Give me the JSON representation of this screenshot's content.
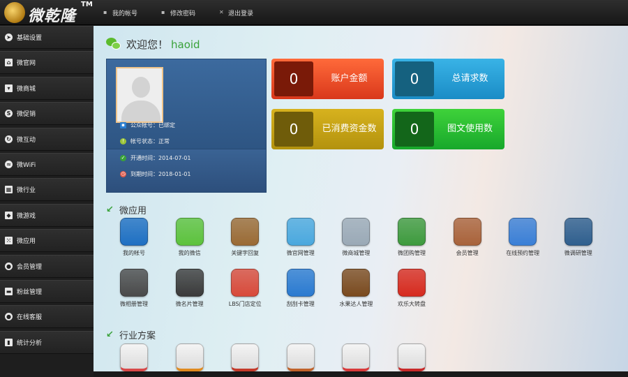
{
  "header": {
    "logo_text": "微乾隆",
    "logo_tm": "TM",
    "nav": [
      {
        "label": "我的帐号",
        "icon": "user-icon"
      },
      {
        "label": "修改密码",
        "icon": "edit-icon"
      },
      {
        "label": "退出登录",
        "icon": "close-icon"
      }
    ]
  },
  "sidebar": {
    "items": [
      {
        "label": "基础设置",
        "icon": "compass-icon"
      },
      {
        "label": "微官网",
        "icon": "home-icon"
      },
      {
        "label": "微商城",
        "icon": "cart-icon"
      },
      {
        "label": "微促销",
        "icon": "skype-icon"
      },
      {
        "label": "微互动",
        "icon": "refresh-icon"
      },
      {
        "label": "微WiFi",
        "icon": "wifi-icon"
      },
      {
        "label": "微行业",
        "icon": "grid-icon"
      },
      {
        "label": "微游戏",
        "icon": "gamepad-icon"
      },
      {
        "label": "微应用",
        "icon": "apps-icon"
      },
      {
        "label": "会员管理",
        "icon": "users-icon"
      },
      {
        "label": "粉丝管理",
        "icon": "card-icon"
      },
      {
        "label": "在线客服",
        "icon": "chat-users-icon"
      },
      {
        "label": "统计分析",
        "icon": "chart-icon"
      }
    ]
  },
  "welcome": {
    "prefix": "欢迎您！",
    "username": "haoid"
  },
  "profile": {
    "rows": [
      {
        "text": "公众帐号：已绑定",
        "icon": "flag-icon",
        "color": "#2b7fd1"
      },
      {
        "text": "帐号状态：正常",
        "icon": "status-icon",
        "color": "#9bc43a"
      },
      {
        "text": "开通时间：2014-07-01",
        "icon": "check-icon",
        "color": "#3aa23a"
      },
      {
        "text": "到期时间：2018-01-01",
        "icon": "alarm-icon",
        "color": "#e05a4a"
      }
    ]
  },
  "stats": [
    {
      "value": "0",
      "label": "账户金额",
      "color": "#e34a26"
    },
    {
      "value": "0",
      "label": "总请求数",
      "color": "#2aa0d6"
    },
    {
      "value": "0",
      "label": "已消费资金数",
      "color": "#c4a317"
    },
    {
      "value": "0",
      "label": "图文使用数",
      "color": "#25b82f"
    }
  ],
  "sections": {
    "apps_title": "微应用",
    "industry_title": "行业方案"
  },
  "apps": [
    {
      "label": "我的帐号",
      "icon": "account-icon",
      "color": "#1e6fc2"
    },
    {
      "label": "我的微信",
      "icon": "message-icon",
      "color": "#5cc23c"
    },
    {
      "label": "关键字回复",
      "icon": "notebook-icon",
      "color": "#9a6a34"
    },
    {
      "label": "微官网管理",
      "icon": "webcam-icon",
      "color": "#4aa8de"
    },
    {
      "label": "微商城管理",
      "icon": "cart-icon",
      "color": "#9aa9b6"
    },
    {
      "label": "微团购管理",
      "icon": "ticket-icon",
      "color": "#3d9a3d"
    },
    {
      "label": "会员管理",
      "icon": "address-book-icon",
      "color": "#a8623a"
    },
    {
      "label": "在线预约管理",
      "icon": "headset-icon",
      "color": "#3a7fd6"
    },
    {
      "label": "微调研管理",
      "icon": "checklist-icon",
      "color": "#2f5f8e"
    },
    {
      "label": "微相册管理",
      "icon": "camera-lens-icon",
      "color": "#4a4a4a"
    },
    {
      "label": "微名片管理",
      "icon": "floppy-icon",
      "color": "#3a3a3a"
    },
    {
      "label": "LBS门店定位",
      "icon": "store-icon",
      "color": "#d84a3a"
    },
    {
      "label": "刮刮卡管理",
      "icon": "chrome-icon",
      "color": "#2a7ad0"
    },
    {
      "label": "水果达人管理",
      "icon": "fruit-icon",
      "color": "#7a4a1e"
    },
    {
      "label": "欢乐大转盘",
      "icon": "yelp-icon",
      "color": "#d62a1e"
    }
  ],
  "industry_apps": [
    {
      "icon": "gift-card-icon",
      "color": "#d84848"
    },
    {
      "icon": "food-icon",
      "color": "#e08a1e"
    },
    {
      "icon": "house-icon",
      "color": "#c43a2a"
    },
    {
      "icon": "door-icon",
      "color": "#c0622a"
    },
    {
      "icon": "medical-icon",
      "color": "#d83a3a"
    },
    {
      "icon": "car-icon",
      "color": "#c82a2a"
    }
  ]
}
